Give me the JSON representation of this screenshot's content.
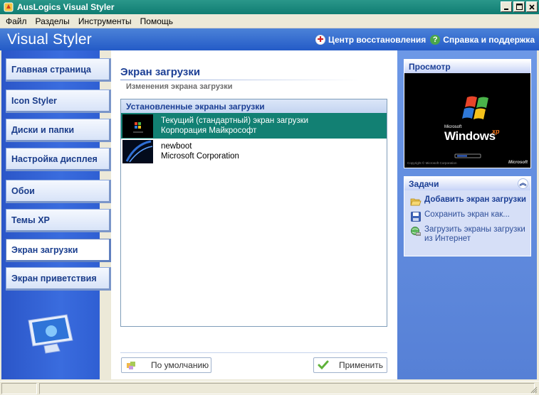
{
  "window": {
    "title": "AusLogics Visual Styler"
  },
  "menu": [
    "Файл",
    "Разделы",
    "Инструменты",
    "Помощь"
  ],
  "header": {
    "app_title": "Visual Styler",
    "restore_center": "Центр восстановления",
    "help_support": "Справка и поддержка"
  },
  "sidebar": {
    "items": [
      {
        "label": "Главная страница"
      },
      {
        "label": "Icon Styler"
      },
      {
        "label": "Диски и папки"
      },
      {
        "label": "Настройка дисплея"
      },
      {
        "label": "Обои"
      },
      {
        "label": "Темы XP"
      },
      {
        "label": "Экран загрузки",
        "active": true
      },
      {
        "label": "Экран приветствия"
      }
    ]
  },
  "main": {
    "title": "Экран загрузки",
    "subtitle": "Изменения экрана загрузки",
    "list_header": "Установленные экраны загрузки",
    "rows": [
      {
        "line1": "Текущий (стандартный) экран загрузки",
        "line2": "Корпорация Майкрософт",
        "selected": true
      },
      {
        "line1": "newboot",
        "line2": "Microsoft Corporation",
        "selected": false
      }
    ],
    "default_button": "По умолчанию",
    "apply_button": "Применить"
  },
  "preview": {
    "header": "Просмотр",
    "logo_text": "Windows",
    "logo_sup": "xp",
    "small_brand": "Microsoft",
    "copyright": "Copyright © Microsoft Corporation"
  },
  "tasks": {
    "header": "Задачи",
    "items": [
      {
        "label": "Добавить экран загрузки",
        "icon": "folder-open-icon"
      },
      {
        "label": "Сохранить экран как...",
        "icon": "floppy-disk-icon"
      },
      {
        "label": "Загрузить экраны загрузки из Интернет",
        "icon": "globe-download-icon"
      }
    ]
  },
  "colors": {
    "title_bar": "#107d72",
    "header_blue": "#245bc7",
    "selection": "#128073",
    "accent_text": "#1c3f95"
  }
}
